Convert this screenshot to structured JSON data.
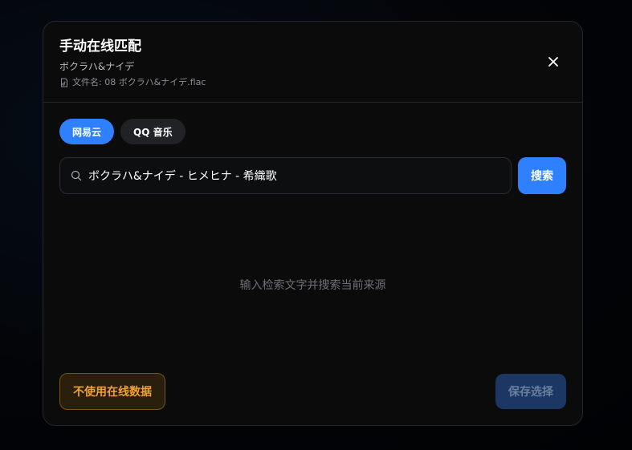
{
  "dialog": {
    "title": "手动在线匹配",
    "subtitle": "ボクラハ&ナイデ",
    "filename_label": "文件名: 08 ボクラハ&ナイデ.flac",
    "close_icon": "close-icon"
  },
  "tabs": [
    {
      "label": "网易云",
      "active": true
    },
    {
      "label": "QQ 音乐",
      "active": false
    }
  ],
  "search": {
    "value": "ボクラハ&ナイデ - ヒメヒナ - 希織歌",
    "button_label": "搜索"
  },
  "empty_state": "输入检索文字并搜索当前来源",
  "footer": {
    "skip_label": "不使用在线数据",
    "save_label": "保存选择"
  },
  "colors": {
    "accent": "#2f80ff",
    "warning": "#f0a12f",
    "panel": "#0b0b0c"
  }
}
